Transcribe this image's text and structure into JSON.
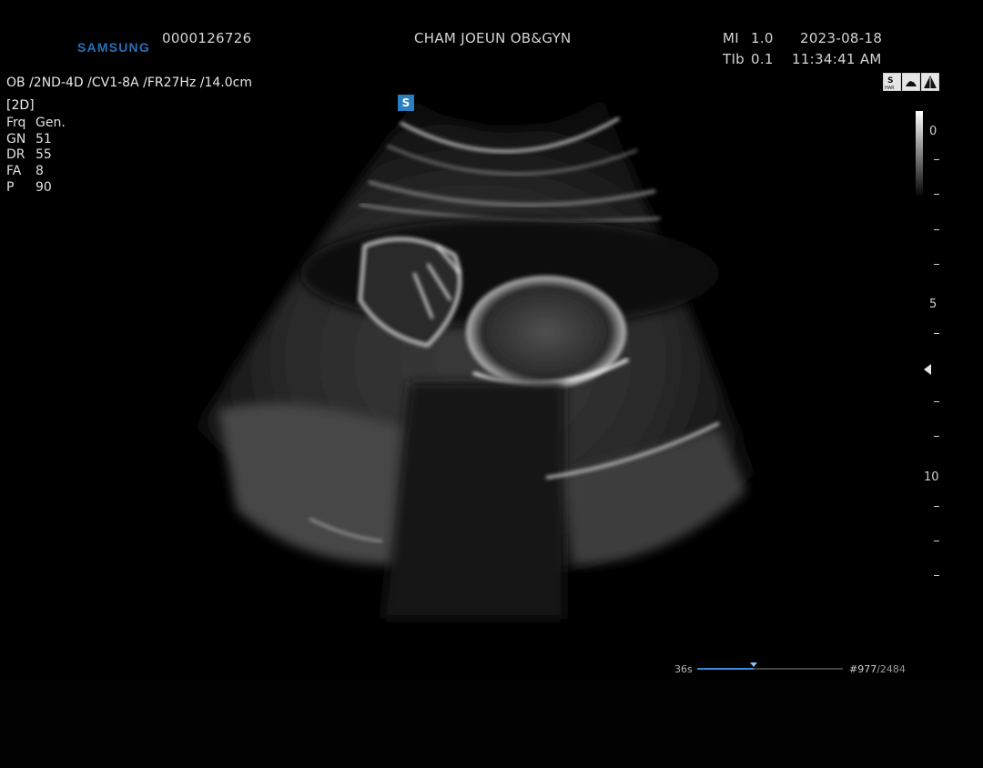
{
  "header": {
    "brand": "SAMSUNG",
    "patient_id": "0000126726",
    "facility": "CHAM JOEUN OB&GYN",
    "mi_label": "MI",
    "mi_value": "1.0",
    "tib_label": "TIb",
    "tib_value": "0.1",
    "date": "2023-08-18",
    "time": "11:34:41 AM"
  },
  "probe_line": "OB /2ND-4D /CV1-8A /FR27Hz /14.0cm",
  "mode": "[2D]",
  "params": [
    {
      "key": "Frq",
      "value": "Gen."
    },
    {
      "key": "GN",
      "value": "51"
    },
    {
      "key": "DR",
      "value": "55"
    },
    {
      "key": "FA",
      "value": "8"
    },
    {
      "key": "P",
      "value": "90"
    }
  ],
  "orientation_marker": "S",
  "status_icons": [
    "s-har-icon",
    "probe-icon",
    "biopsy-icon"
  ],
  "depth_scale": {
    "labels": [
      "0",
      "5",
      "10"
    ],
    "focus_marker": "focus-arrow-icon"
  },
  "cine": {
    "elapsed": "36s",
    "frame": "#977",
    "total": "/2484",
    "progress": 0.39
  },
  "colors": {
    "brand": "#2a6fb5",
    "accent": "#2a7fc1",
    "cine_fill": "#3a8bd8"
  }
}
